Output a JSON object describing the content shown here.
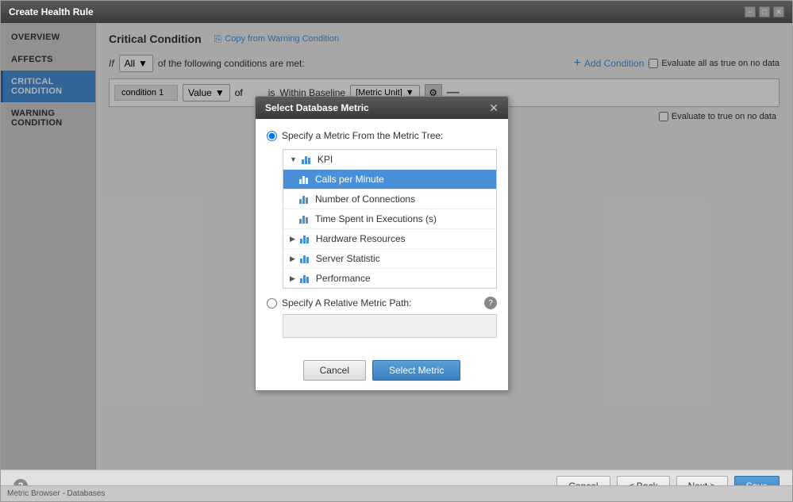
{
  "window": {
    "title": "Create Health Rule",
    "close_btn": "✕",
    "maximize_btn": "□",
    "minimize_btn": "−"
  },
  "sidebar": {
    "items": [
      {
        "id": "overview",
        "label": "OVERVIEW",
        "active": false
      },
      {
        "id": "affects",
        "label": "AFFECTS",
        "active": false
      },
      {
        "id": "critical-condition",
        "label": "CRITICAL CONDITION",
        "active": true
      },
      {
        "id": "warning-condition",
        "label": "WARNING CONDITION",
        "active": false
      }
    ]
  },
  "main": {
    "title": "Critical Condition",
    "copy_link": "Copy from Warning Condition",
    "copy_icon": "⎘",
    "if_label": "If",
    "all_option": "All",
    "condition_text": "of the following conditions are met:",
    "add_condition_label": "Add Condition",
    "add_icon": "+",
    "evaluate_all_label": "Evaluate all as true on no data",
    "evaluate_true_label": "Evaluate to true on no data",
    "value_option": "Value",
    "of_label": "of",
    "is_label": "is",
    "condition_name": "condition 1",
    "within_baseline": "Within Baseline",
    "metric_unit": "[Metric Unit]"
  },
  "modal": {
    "title": "Select Database Metric",
    "close_btn": "✕",
    "specify_from_tree_label": "Specify a Metric From the Metric Tree:",
    "specify_relative_label": "Specify A Relative Metric Path:",
    "help_icon": "?",
    "tree_items": [
      {
        "id": "kpi",
        "label": "KPI",
        "level": 0,
        "type": "folder",
        "arrow": "▼",
        "selected": false
      },
      {
        "id": "calls-per-minute",
        "label": "Calls per Minute",
        "level": 1,
        "type": "metric",
        "selected": true
      },
      {
        "id": "number-of-connections",
        "label": "Number of Connections",
        "level": 1,
        "type": "metric",
        "selected": false
      },
      {
        "id": "time-spent-in-executions",
        "label": "Time Spent in Executions (s)",
        "level": 1,
        "type": "metric",
        "selected": false
      },
      {
        "id": "hardware-resources",
        "label": "Hardware Resources",
        "level": 0,
        "type": "folder",
        "arrow": "▶",
        "selected": false
      },
      {
        "id": "server-statistic",
        "label": "Server Statistic",
        "level": 0,
        "type": "folder",
        "arrow": "▶",
        "selected": false
      },
      {
        "id": "performance",
        "label": "Performance",
        "level": 0,
        "type": "folder",
        "arrow": "▶",
        "selected": false
      }
    ],
    "cancel_btn": "Cancel",
    "select_btn": "Select Metric"
  },
  "footer": {
    "help_icon": "?",
    "cancel_btn": "Cancel",
    "back_btn": "< Back",
    "next_btn": "Next >",
    "save_btn": "Save"
  },
  "status_bar": {
    "text": "Metric Browser - Databases"
  }
}
